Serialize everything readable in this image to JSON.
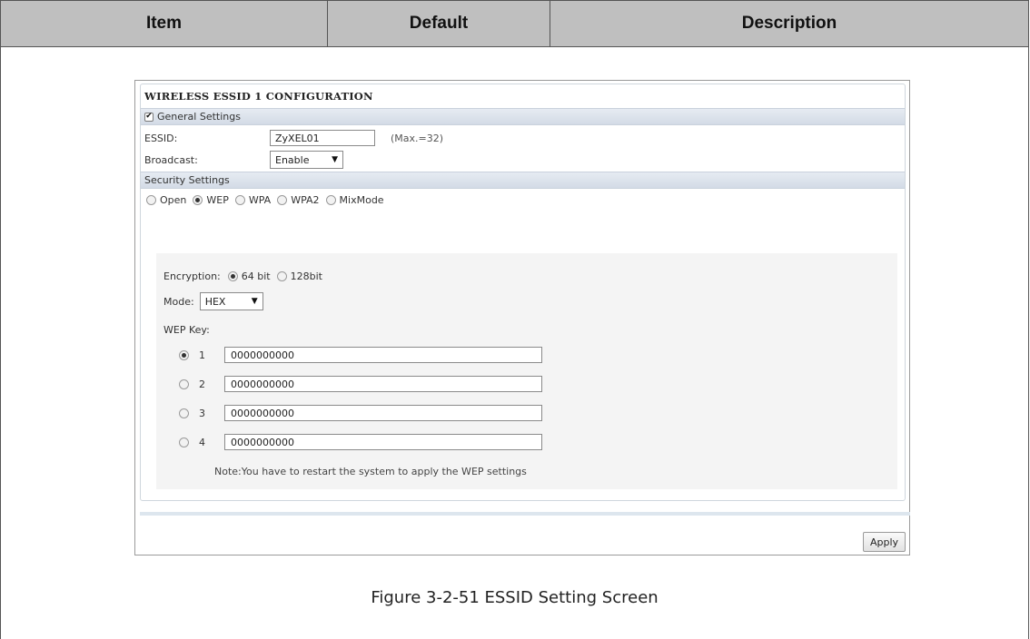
{
  "doc_table": {
    "headers": [
      "Item",
      "Default",
      "Description"
    ],
    "caption": "Figure 3-2-51 ESSID Setting Screen"
  },
  "panel": {
    "title": "WIRELESS ESSID 1 CONFIGURATION",
    "general_settings_label": "General Settings",
    "essid_label": "ESSID:",
    "essid_value": "ZyXEL01",
    "essid_hint": "(Max.=32)",
    "broadcast_label": "Broadcast:",
    "broadcast_value": "Enable",
    "security_settings_label": "Security Settings",
    "security_options": [
      "Open",
      "WEP",
      "WPA",
      "WPA2",
      "MixMode"
    ],
    "security_selected": "WEP",
    "encryption_label": "Encryption:",
    "encryption_options": [
      "64 bit",
      "128bit"
    ],
    "encryption_selected": "64 bit",
    "mode_label": "Mode:",
    "mode_value": "HEX",
    "wep_key_label": "WEP Key:",
    "wep_keys": [
      {
        "index": "1",
        "value": "0000000000",
        "selected": true
      },
      {
        "index": "2",
        "value": "0000000000",
        "selected": false
      },
      {
        "index": "3",
        "value": "0000000000",
        "selected": false
      },
      {
        "index": "4",
        "value": "0000000000",
        "selected": false
      }
    ],
    "note": "Note:You have to restart the system to apply the WEP settings",
    "apply_label": "Apply"
  }
}
